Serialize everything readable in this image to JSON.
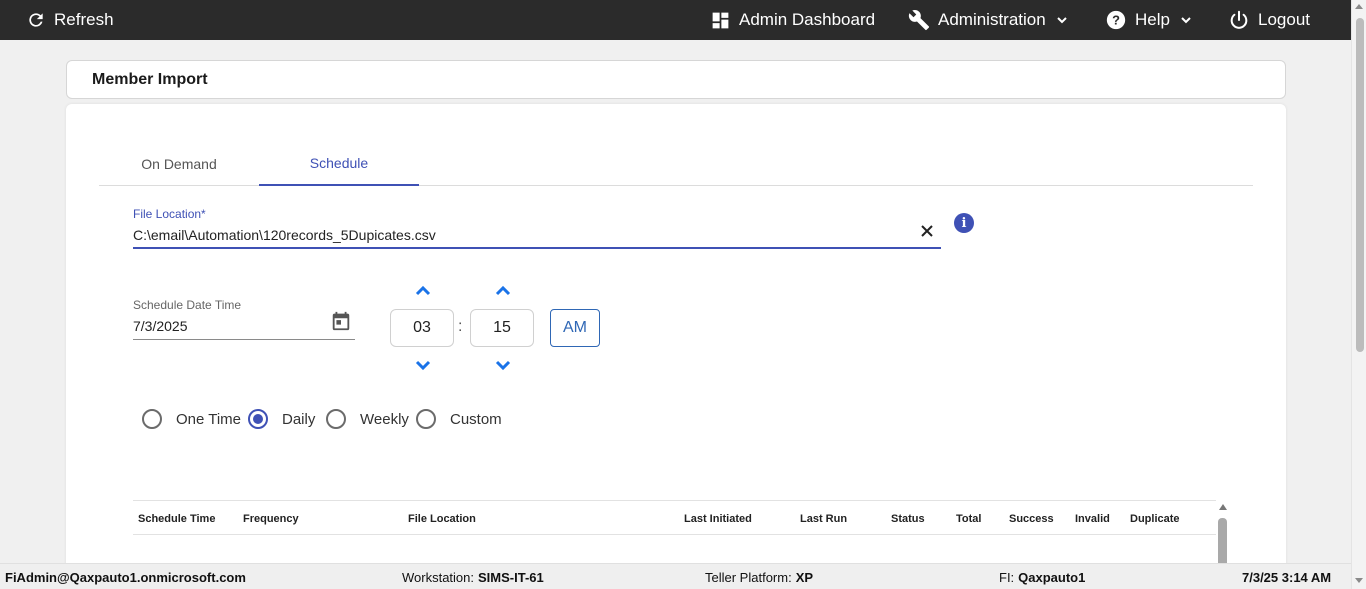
{
  "nav": {
    "refresh": "Refresh",
    "admin_dashboard": "Admin Dashboard",
    "administration": "Administration",
    "help": "Help",
    "logout": "Logout"
  },
  "page": {
    "title": "Member Import"
  },
  "tabs": [
    {
      "label": "On Demand",
      "active": false
    },
    {
      "label": "Schedule",
      "active": true
    }
  ],
  "file_location": {
    "label": "File Location*",
    "value": "C:\\email\\Automation\\120records_5Dupicates.csv"
  },
  "schedule": {
    "label": "Schedule Date Time",
    "date": "7/3/2025",
    "hour": "03",
    "separator": ":",
    "minute": "15",
    "ampm": "AM"
  },
  "frequency": {
    "options": [
      "One Time",
      "Daily",
      "Weekly",
      "Custom"
    ],
    "selected": "Daily"
  },
  "table": {
    "columns": [
      "Schedule Time",
      "Frequency",
      "File Location",
      "Last Initiated",
      "Last Run",
      "Status",
      "Total",
      "Success",
      "Invalid",
      "Duplicate"
    ]
  },
  "status_bar": {
    "user": "FiAdmin@Qaxpauto1.onmicrosoft.com",
    "workstation_label": "Workstation:",
    "workstation": "SIMS-IT-61",
    "teller_label": "Teller Platform:",
    "teller": "XP",
    "fi_label": "FI:",
    "fi": "Qaxpauto1",
    "datetime": "7/3/25 3:14 AM"
  },
  "colors": {
    "accent": "#3f51b5",
    "ampm_blue": "#2f67b5",
    "arrow_blue": "#1a73e8",
    "topbar": "#2b2b2b"
  }
}
